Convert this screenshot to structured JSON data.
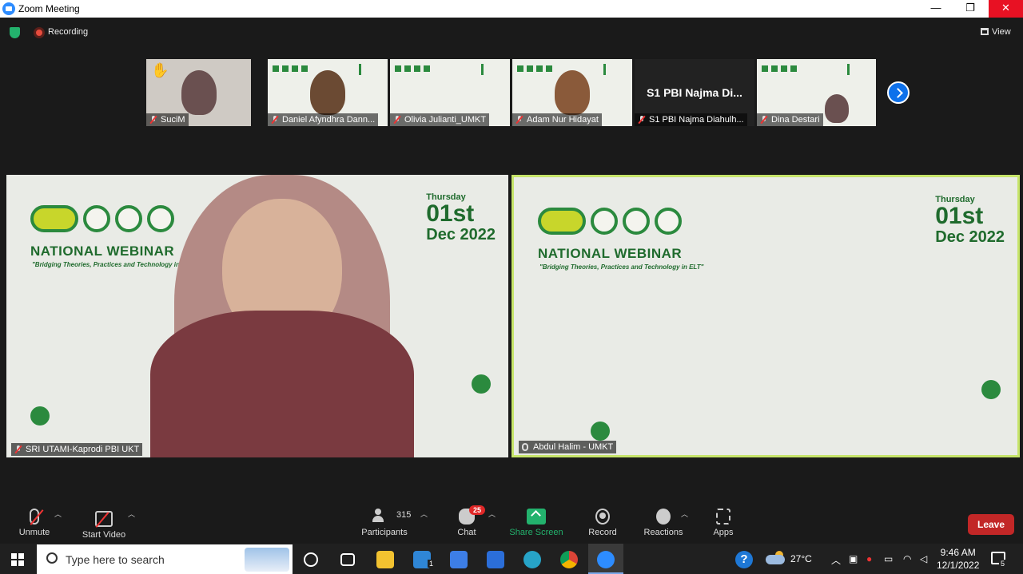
{
  "window": {
    "title": "Zoom Meeting",
    "minimize": "—",
    "maximize": "❐",
    "close": "✕"
  },
  "meeting": {
    "recording_label": "Recording",
    "view_label": "View"
  },
  "strip": [
    {
      "name": "SuciM",
      "hand_raised": "✋"
    },
    {
      "name": "Daniel Afyndhra Dann..."
    },
    {
      "name": "Olivia Julianti_UMKT"
    },
    {
      "name": "Adam Nur Hidayat"
    },
    {
      "name": "S1 PBI Najma Diahulh...",
      "display_name": "S1 PBI Najma Di..."
    },
    {
      "name": "Dina Destari"
    }
  ],
  "main_videos": [
    {
      "name": "SRI UTAMI-Kaprodi PBI UKT"
    },
    {
      "name": "Abdul Halim - UMKT",
      "active": true
    }
  ],
  "webinar": {
    "title": "NATIONAL WEBINAR",
    "subtitle": "\"Bridging Theories, Practices and Technology in ELT\"",
    "day": "Thursday",
    "date_num": "01st",
    "month_year": "Dec 2022"
  },
  "toolbar": {
    "unmute": "Unmute",
    "start_video": "Start Video",
    "participants": "Participants",
    "participant_count": "315",
    "chat": "Chat",
    "chat_badge": "25",
    "share_screen": "Share Screen",
    "record": "Record",
    "reactions": "Reactions",
    "apps": "Apps",
    "leave": "Leave"
  },
  "taskbar": {
    "search_placeholder": "Type here to search",
    "help": "?",
    "temperature": "27°C",
    "time": "9:46 AM",
    "date": "12/1/2022",
    "notifications": "5",
    "mail_badge": "1"
  },
  "colors": {
    "accent": "#2d8cff",
    "leave": "#c22727",
    "share": "#23b26d",
    "active_border": "#c6e46a",
    "webinar_green": "#1f6b2d"
  }
}
